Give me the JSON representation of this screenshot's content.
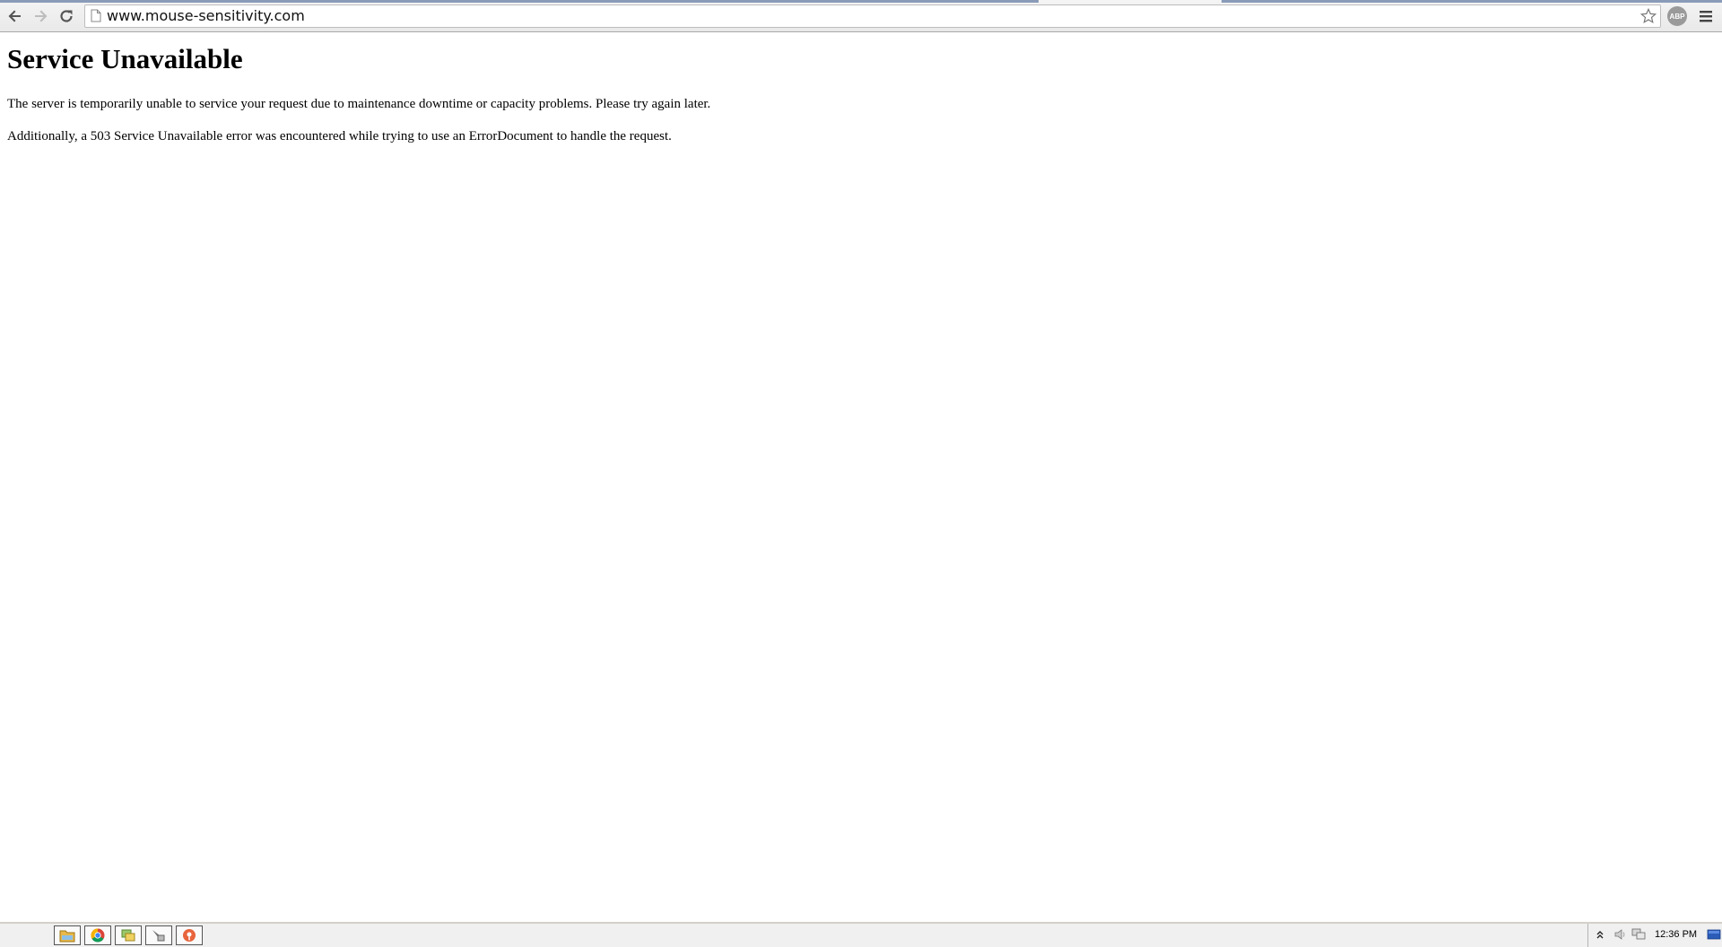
{
  "browser": {
    "url": "www.mouse-sensitivity.com",
    "extension_badge": "ABP"
  },
  "page": {
    "heading": "Service Unavailable",
    "paragraph_1": "The server is temporarily unable to service your request due to maintenance downtime or capacity problems. Please try again later.",
    "paragraph_2": "Additionally, a 503 Service Unavailable error was encountered while trying to use an ErrorDocument to handle the request."
  },
  "taskbar": {
    "apps": [
      "file-explorer-icon",
      "chrome-icon",
      "folders-icon",
      "tool-icon",
      "app-icon"
    ],
    "clock": "12:36 PM"
  },
  "colors": {
    "toolbar_bg": "#eeeeee",
    "chrome_red": "#db4437",
    "chrome_green": "#0f9d58",
    "chrome_yellow": "#f4b400",
    "chrome_blue": "#4285f4"
  }
}
